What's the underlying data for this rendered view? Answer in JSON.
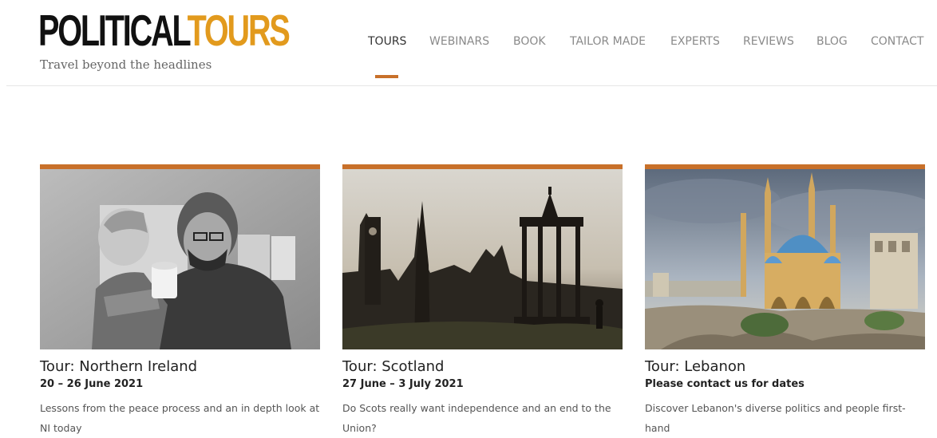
{
  "brand": {
    "logo_part1": "POLITICAL",
    "logo_part2": "TOURS",
    "tagline": "Travel beyond the headlines",
    "colors": {
      "accent": "#c8702a",
      "logo_orange": "#e29a1d"
    }
  },
  "nav": {
    "items": [
      "TOURS",
      "WEBINARS",
      "BOOK",
      "TAILOR MADE",
      "EXPERTS",
      "REVIEWS",
      "BLOG",
      "CONTACT"
    ],
    "active": "TOURS"
  },
  "tours": [
    {
      "title": "Tour: Northern Ireland",
      "dates": "20 – 26 June 2021",
      "description": "Lessons from the peace process and an in depth look at NI today",
      "image": "black-and-white photo of a man holding a child drinking from a mug"
    },
    {
      "title": "Tour: Scotland",
      "dates": "27 June – 3 July 2021",
      "description": "Do Scots really want independence and an end to the Union?",
      "image": "silhouette of Edinburgh skyline with monument"
    },
    {
      "title": "Tour: Lebanon",
      "dates": "Please contact us for dates",
      "description": "Discover Lebanon's diverse politics and people first-hand",
      "image": "Beirut mosque with blue domes and minarets"
    }
  ]
}
